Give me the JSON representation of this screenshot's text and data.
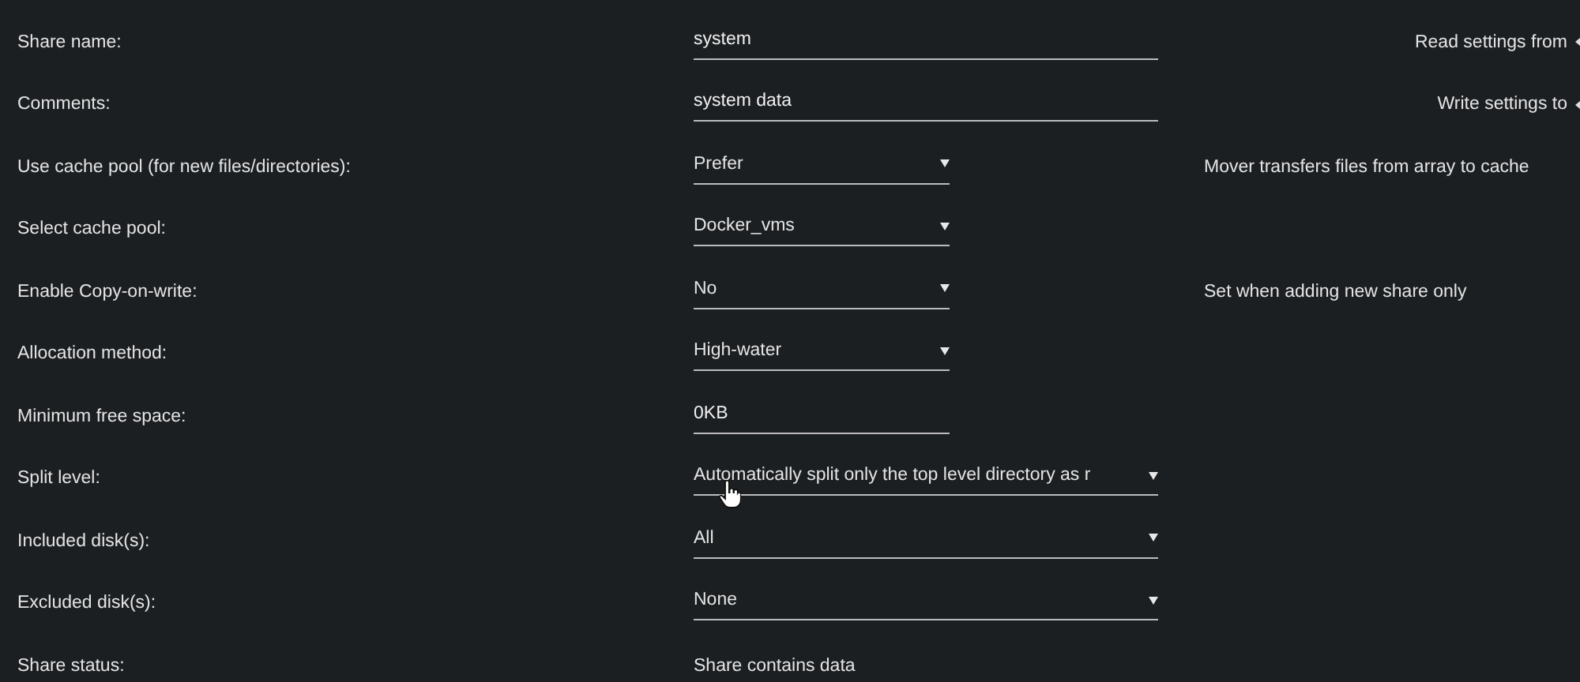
{
  "settings": [
    {
      "label": "Share name:",
      "kind": "input",
      "value": "system",
      "wide": true,
      "note": {
        "text": "Read settings from",
        "kind": "action"
      }
    },
    {
      "label": "Comments:",
      "kind": "input",
      "value": "system data",
      "wide": true,
      "note": {
        "text": "Write settings to",
        "kind": "action"
      }
    },
    {
      "label": "Use cache pool (for new files/directories):",
      "kind": "select",
      "value": "Prefer",
      "wide": false,
      "note": {
        "text": "Mover transfers files from array to cache",
        "kind": "info"
      }
    },
    {
      "label": "Select cache pool:",
      "kind": "select",
      "value": "Docker_vms",
      "wide": false
    },
    {
      "label": "Enable Copy-on-write:",
      "kind": "select",
      "value": "No",
      "wide": false,
      "note": {
        "text": "Set when adding new share only",
        "kind": "info"
      }
    },
    {
      "label": "Allocation method:",
      "kind": "select",
      "value": "High-water",
      "wide": false
    },
    {
      "label": "Minimum free space:",
      "kind": "input",
      "value": "0KB",
      "wide": false
    },
    {
      "label": "Split level:",
      "kind": "select",
      "value": "Automatically split only the top level directory as r",
      "wide": true
    },
    {
      "label": "Included disk(s):",
      "kind": "select",
      "value": "All",
      "wide": true
    },
    {
      "label": "Excluded disk(s):",
      "kind": "select",
      "value": "None",
      "wide": true
    },
    {
      "label": "Share status:",
      "kind": "text",
      "value": "Share contains data"
    }
  ]
}
